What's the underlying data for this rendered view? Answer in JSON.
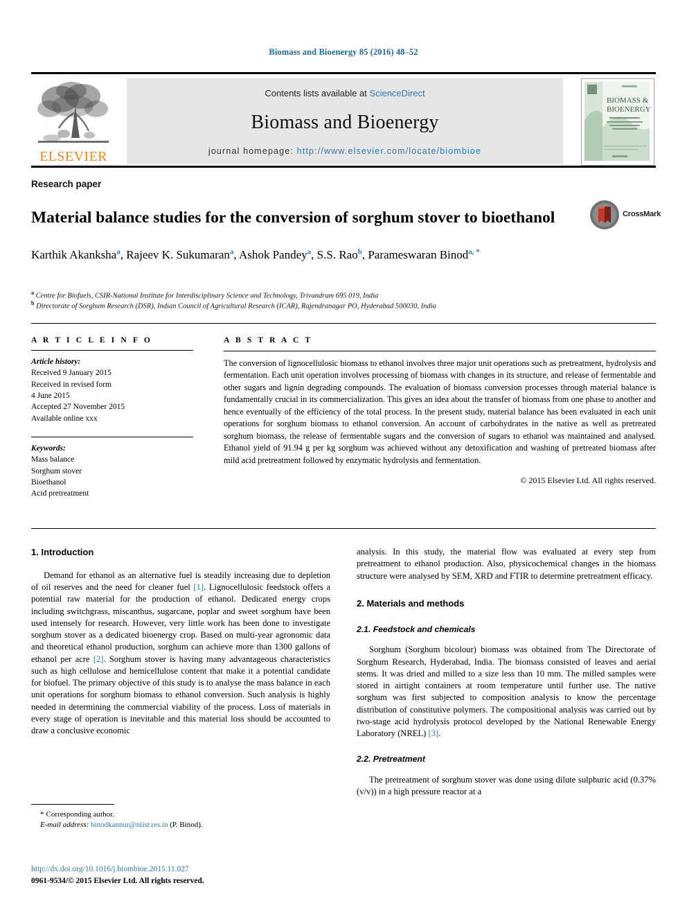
{
  "running_head": "Biomass and Bioenergy 85 (2016) 48–52",
  "masthead": {
    "publisher_name": "ELSEVIER",
    "contents_prefix": "Contents lists available at ",
    "contents_link": "ScienceDirect",
    "journal_title": "Biomass and Bioenergy",
    "homepage_prefix": "journal homepage: ",
    "homepage_url": "http://www.elsevier.com/locate/biombioe",
    "cover": {
      "line1": "BIOMASS &",
      "line2": "BIOENERGY",
      "publisher_mark": "ELSEVIER"
    }
  },
  "article": {
    "type": "Research paper",
    "title": "Material balance studies for the conversion of sorghum stover to bioethanol",
    "crossmark_label": "CrossMark",
    "authors": [
      {
        "name": "Karthik Akanksha",
        "marks": "a",
        "sep": ", "
      },
      {
        "name": "Rajeev K. Sukumaran",
        "marks": "a",
        "sep": ", "
      },
      {
        "name": "Ashok Pandey",
        "marks": "a",
        "sep": ", "
      },
      {
        "name": "S.S. Rao",
        "marks": "b",
        "sep": ", "
      },
      {
        "name": "Parameswaran Binod",
        "marks": "a, *",
        "sep": ""
      }
    ],
    "affiliations": [
      {
        "mark": "a",
        "text": "Centre for Biofuels, CSIR-National Institute for Interdisciplinary Science and Technology, Trivandrum 695 019, India"
      },
      {
        "mark": "b",
        "text": "Directorate of Sorghum Research (DSR), Indian Council of Agricultural Research (ICAR), Rajendranagar PO, Hyderabad 500030, India"
      }
    ]
  },
  "info": {
    "heading": "A R T I C L E   I N F O",
    "history_label": "Article history:",
    "history": [
      "Received 9 January 2015",
      "Received in revised form",
      "4 June 2015",
      "Accepted 27 November 2015",
      "Available online xxx"
    ],
    "keywords_label": "Keywords:",
    "keywords": [
      "Mass balance",
      "Sorghum stover",
      "Bioethanol",
      "Acid pretreatment"
    ]
  },
  "abstract": {
    "heading": "A B S T R A C T",
    "text": "The conversion of lignocellulosic biomass to ethanol involves three major unit operations such as pretreatment, hydrolysis and fermentation. Each unit operation involves processing of biomass with changes in its structure, and release of fermentable and other sugars and lignin degrading compounds. The evaluation of biomass conversion processes through material balance is fundamentally crucial in its commercialization. This gives an idea about the transfer of biomass from one phase to another and hence eventually of the efficiency of the total process. In the present study, material balance has been evaluated in each unit operations for sorghum biomass to ethanol conversion. An account of carbohydrates in the native as well as pretreated sorghum biomass, the release of fermentable sugars and the conversion of sugars to ethanol was maintained and analysed. Ethanol yield of 91.94 g per kg sorghum was achieved without any detoxification and washing of pretreated biomass after mild acid pretreatment followed by enzymatic hydrolysis and fermentation.",
    "copyright": "© 2015 Elsevier Ltd. All rights reserved."
  },
  "body": {
    "intro_heading": "1. Introduction",
    "intro_p1_a": "Demand for ethanol as an alternative fuel is steadily increasing due to depletion of oil reserves and the need for cleaner fuel ",
    "intro_ref1": "[1]",
    "intro_p1_b": ". Lignocellulosic feedstock offers a potential raw material for the production of ethanol. Dedicated energy crops including switchgrass, miscanthus, sugarcane, poplar and sweet sorghum have been used intensely for research. However, very little work has been done to investigate sorghum stover as a dedicated bioenergy crop. Based on multi-year agronomic data and theoretical ethanol production, sorghum can achieve more than 1300 gallons of ethanol per acre ",
    "intro_ref2": "[2]",
    "intro_p1_c": ". Sorghum stover is having many advantageous characteristics such as high cellulose and hemicellulose content that make it a potential candidate for biofuel. The primary objective of this study is to analyse the mass balance in each unit operations for sorghum biomass to ethanol conversion. Such analysis is highly needed in determining the commercial viability of the process. Loss of materials in every stage of operation is inevitable and this material loss should be accounted to draw a conclusive economic",
    "intro_p1_d": "analysis. In this study, the material flow was evaluated at every step from pretreatment to ethanol production. Also, physicochemical changes in the biomass structure were analysed by SEM, XRD and FTIR to determine pretreatment efficacy.",
    "methods_heading": "2. Materials and methods",
    "feedstock_heading": "2.1. Feedstock and chemicals",
    "feedstock_p_a": "Sorghum (Sorghum bicolour) biomass was obtained from The Directorate of Sorghum Research, Hyderabad, India. The biomass consisted of leaves and aerial stems. It was dried and milled to a size less than 10 mm. The milled samples were stored in airtight containers at room temperature until further use. The native sorghum was first subjected to composition analysis to know the percentage distribution of constitutive polymers. The compositional analysis was carried out by two-stage acid hydrolysis protocol developed by the National Renewable Energy Laboratory (NREL) ",
    "feedstock_ref3": "[3]",
    "feedstock_p_b": ".",
    "pretreatment_heading": "2.2. Pretreatment",
    "pretreatment_p": "The pretreatment of sorghum stover was done using dilute sulphuric acid (0.37% (v/v)) in a high pressure reactor at a"
  },
  "footer": {
    "corresponding_star": "*",
    "corresponding_label": "Corresponding author.",
    "email_label": "E-mail address:",
    "email": "binodkannur@niist.res.in",
    "email_suffix": "(P. Binod).",
    "doi_url": "http://dx.doi.org/10.1016/j.biombioe.2015.11.027",
    "issn_line": "0961-9534/© 2015 Elsevier Ltd. All rights reserved."
  },
  "colors": {
    "link_blue": "#2b7ab5",
    "elsevier_orange": "#f28724",
    "banner_gray": "#e6e6e6",
    "cover_green": "#7fa383"
  }
}
